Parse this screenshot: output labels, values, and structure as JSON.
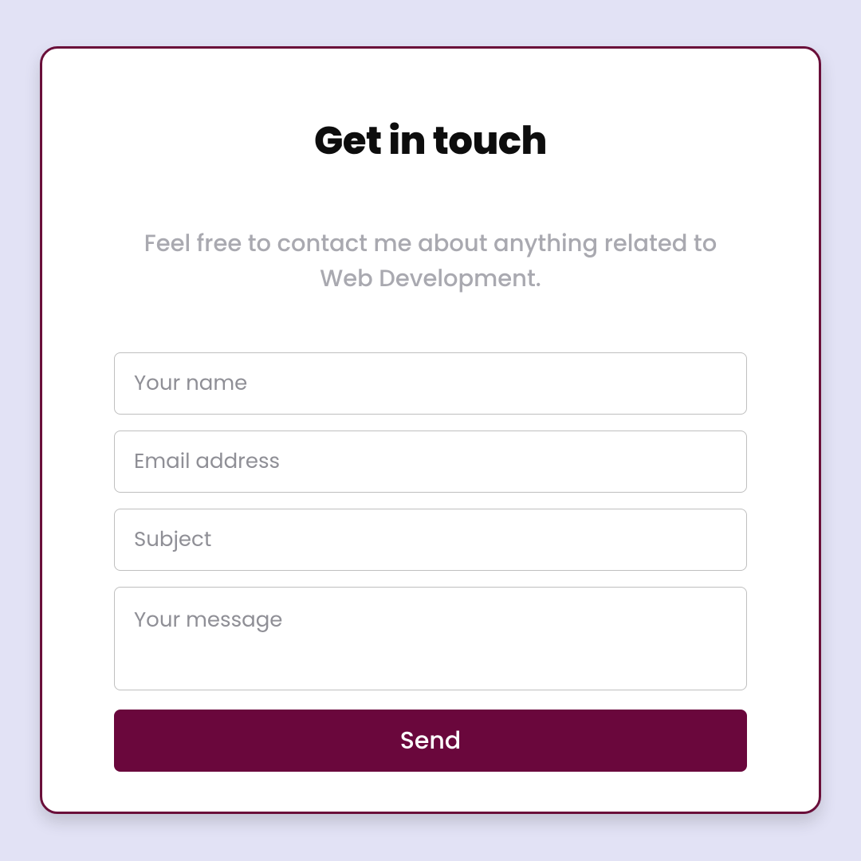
{
  "title": "Get in touch",
  "subtitle": "Feel free to contact me about anything related to Web Development.",
  "form": {
    "name": {
      "placeholder": "Your name",
      "value": ""
    },
    "email": {
      "placeholder": "Email address",
      "value": ""
    },
    "subject": {
      "placeholder": "Subject",
      "value": ""
    },
    "message": {
      "placeholder": "Your message",
      "value": ""
    },
    "submit_label": "Send"
  },
  "colors": {
    "background": "#e2e2f5",
    "card_border": "#6a0f3a",
    "button_bg": "#6a073c",
    "placeholder": "#8f8f96",
    "subtitle": "#a9a9b0"
  }
}
